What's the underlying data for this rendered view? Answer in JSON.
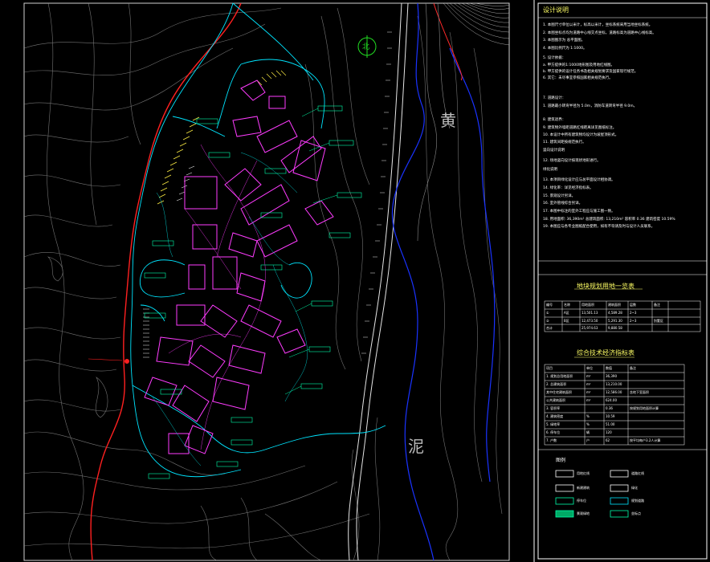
{
  "drawing": {
    "river_char_top": "黄",
    "river_char_bottom": "泥",
    "north_symbol": "北"
  },
  "panel": {
    "title": "设计说明",
    "table1_title": "地块规划用地一览表",
    "table2_title": "综合技术经济指标表",
    "legend_title": "图例",
    "notes": [
      "1. 本图尺寸单位以米计，标高以米计，坐标系统采用当地坐标系统。",
      "2. 本图坐标点均为道路中心线交点坐标，道路标高为道路中心线标高。",
      "3. 本图图示为 总平面图。",
      "4. 本图比例尺为 1:1000。",
      "5. 设计依据：",
      "   a. 甲方提供的1:1000地形图及用地红线图。",
      "   b. 甲方提供的设计任务书及相关规划要求及国家现行规范。",
      "6. 其它：未尽事宜参照国家相关规范执行。",
      "7. 道路设计：",
      "1. 道路最小转弯半径为 5.0m，消防车道转弯半径 9.0m。",
      "8. 建筑退界：",
      "9. 建筑物外墙距道路红线距离详见图纸标注。",
      "10. 本设计中所有建筑物均设计为坡屋顶形式。",
      "11. 建筑间距按规范执行。",
      "竖向设计说明",
      "12. 场地竖向设计按现状地形进行。",
      "绿化说明",
      "13. 本项目绿化设计应与总平面设计相协调。",
      "14. 绿化率：详见经济指标表。",
      "15. 景观设计另详。",
      "16. 室外管线综合另详。",
      "17. 本图中标注的室外工程应与施工图一致。",
      "18. 用地面积: 36,390m²  总建筑面积: 13,210m²  容积率 0.36  建筑密度 10.59%",
      "19. 本图应与各专业图纸配合使用，如有不符请及时与设计人员联系。"
    ],
    "table1_headers": [
      "编号",
      "名称",
      "用地面积",
      "建筑面积",
      "层数",
      "备注"
    ],
    "table1_rows": [
      [
        "①",
        "A区",
        "13,501.13",
        "4,589.28",
        "2~3",
        ""
      ],
      [
        "②",
        "B区",
        "12,473.50",
        "5,291.30",
        "2~3",
        "别墅区"
      ],
      [
        "合计",
        "",
        "25,974.63",
        "9,880.58",
        "",
        ""
      ]
    ],
    "table2_headers": [
      "项目",
      "单位",
      "数值",
      "备注"
    ],
    "table2_rows": [
      [
        "1. 规划总用地面积",
        "m²",
        "36,390",
        ""
      ],
      [
        "2. 总建筑面积",
        "m²",
        "13,210.00",
        ""
      ],
      [
        "  其中住宅建筑面积",
        "m²",
        "12,586.00",
        "含地下室面积"
      ],
      [
        "  公共建筑面积",
        "m²",
        "624.00",
        ""
      ],
      [
        "3. 容积率",
        "",
        "0.36",
        "按规划用地面积计算"
      ],
      [
        "4. 建筑密度",
        "%",
        "10.59",
        ""
      ],
      [
        "5. 绿地率",
        "%",
        "51.00",
        ""
      ],
      [
        "6. 停车位",
        "辆",
        "120",
        ""
      ],
      [
        "7. 户数",
        "户",
        "62",
        "按平均每户3.2人计算"
      ]
    ],
    "legend_items": [
      {
        "label": "用地红线"
      },
      {
        "label": "道路红线"
      },
      {
        "label": "新建建筑"
      },
      {
        "label": "绿化"
      },
      {
        "label": "停车位"
      },
      {
        "label": "规划道路"
      },
      {
        "label": "景观绿地"
      },
      {
        "label": "坐标点"
      }
    ]
  },
  "colors": {
    "background": "#000000",
    "contour": "#bfbfbf",
    "road": "#00e5ff",
    "building": "#ff3cff",
    "redline": "#ff2020",
    "text_label": "#00ffaa",
    "river": "#1a33ff",
    "panel_border": "#ffffff",
    "title_yellow": "#ffff66"
  }
}
